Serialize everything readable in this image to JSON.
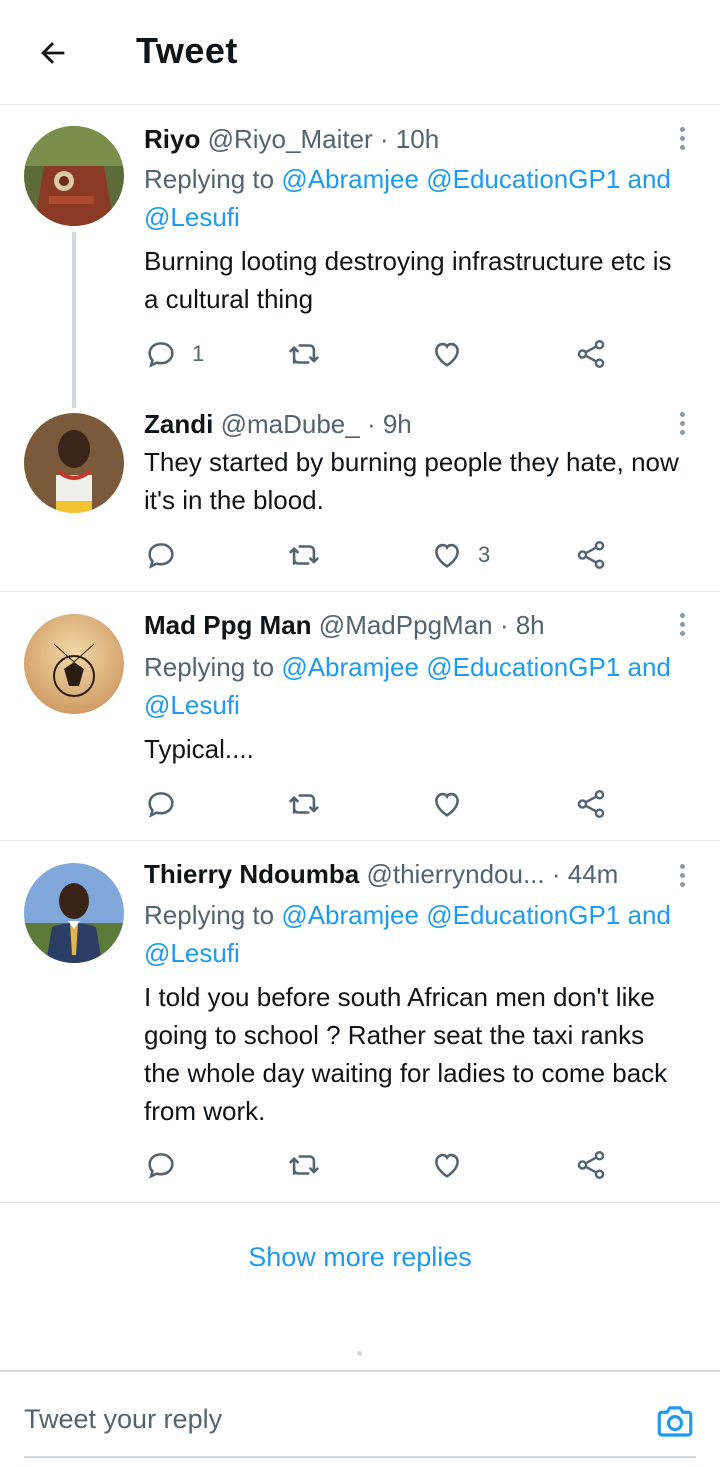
{
  "header": {
    "title": "Tweet"
  },
  "tweets": [
    {
      "name": "Riyo",
      "handle": "@Riyo_Maiter",
      "time": "· 10h",
      "replying_prefix": "Replying to ",
      "mentions_line1": "@Abramjee @EducationGP1 and",
      "mentions_line2": "@Lesufi",
      "text": "Burning looting destroying infrastructure etc is a cultural thing",
      "reply_count": "1",
      "retweet_count": "",
      "like_count": ""
    },
    {
      "name": "Zandi",
      "handle": "@maDube_",
      "time": "· 9h",
      "text": "They started by burning people they hate, now it's in the blood.",
      "reply_count": "",
      "retweet_count": "",
      "like_count": "3"
    },
    {
      "name": "Mad Ppg Man",
      "handle": "@MadPpgMan",
      "time": "· 8h",
      "replying_prefix": "Replying to ",
      "mentions_line1": "@Abramjee @EducationGP1 and",
      "mentions_line2": "@Lesufi",
      "text": "Typical....",
      "reply_count": "",
      "retweet_count": "",
      "like_count": ""
    },
    {
      "name": "Thierry Ndoumba",
      "handle": "@thierryndou...",
      "time": "· 44m",
      "replying_prefix": "Replying to ",
      "mentions_line1": "@Abramjee @EducationGP1 and",
      "mentions_line2": "@Lesufi",
      "text": "I told you before south African men don't like going to school ? Rather seat the taxi ranks the whole day waiting for ladies to come back from work.",
      "reply_count": "",
      "retweet_count": "",
      "like_count": ""
    }
  ],
  "show_more": "Show more replies",
  "compose": {
    "placeholder": "Tweet your reply"
  },
  "colors": {
    "accent": "#1d9bf0",
    "text": "#0f1419",
    "secondary": "#536471",
    "divider": "#e4e8eb"
  },
  "icons": [
    "back-arrow-icon",
    "more-icon",
    "reply-icon",
    "retweet-icon",
    "like-icon",
    "share-icon",
    "camera-icon"
  ]
}
